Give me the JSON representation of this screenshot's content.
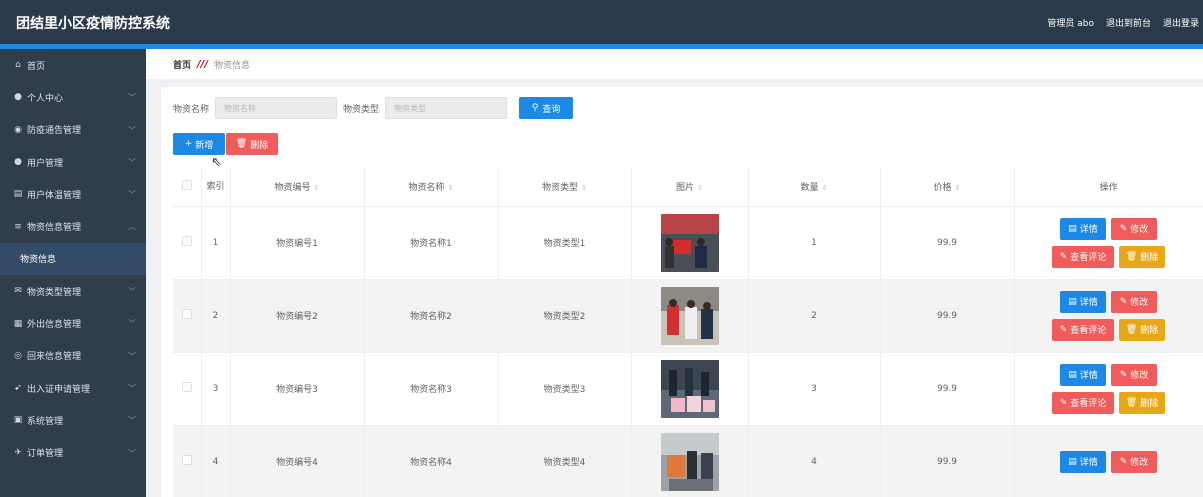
{
  "header": {
    "app_title": "团结里小区疫情防控系统",
    "admin_label": "管理员 abo",
    "back_frontend": "退出到前台",
    "logout": "退出登录"
  },
  "sidebar": {
    "items": [
      {
        "label": "首页",
        "icon": "home-icon"
      },
      {
        "label": "个人中心",
        "icon": "user-icon"
      },
      {
        "label": "防疫通告管理",
        "icon": "pin-icon"
      },
      {
        "label": "用户管理",
        "icon": "user-icon"
      },
      {
        "label": "用户体温管理",
        "icon": "doc-icon"
      },
      {
        "label": "物资信息管理",
        "icon": "menu-icon"
      },
      {
        "label": "物资信息",
        "icon": ""
      },
      {
        "label": "物资类型管理",
        "icon": "mail-icon"
      },
      {
        "label": "外出信息管理",
        "icon": "grid-icon"
      },
      {
        "label": "回来信息管理",
        "icon": "circle-icon"
      },
      {
        "label": "出入证申请管理",
        "icon": "send-icon"
      },
      {
        "label": "系统管理",
        "icon": "screen-icon"
      },
      {
        "label": "订单管理",
        "icon": "plane-icon"
      }
    ]
  },
  "breadcrumb": {
    "home": "首页",
    "separator": "///",
    "current": "物资信息"
  },
  "search": {
    "name_label": "物资名称",
    "name_placeholder": "物资名称",
    "type_label": "物资类型",
    "type_placeholder": "物资类型",
    "search_button": "查询"
  },
  "actions": {
    "add": "新增",
    "delete": "删除"
  },
  "table": {
    "headers": [
      "",
      "索引",
      "物资编号",
      "物资名称",
      "物资类型",
      "图片",
      "数量",
      "价格",
      "操作"
    ],
    "rows": [
      {
        "index": "1",
        "code": "物资编号1",
        "name": "物资名称1",
        "type": "物资类型1",
        "qty": "1",
        "price": "99.9"
      },
      {
        "index": "2",
        "code": "物资编号2",
        "name": "物资名称2",
        "type": "物资类型2",
        "qty": "2",
        "price": "99.9"
      },
      {
        "index": "3",
        "code": "物资编号3",
        "name": "物资名称3",
        "type": "物资类型3",
        "qty": "3",
        "price": "99.9"
      },
      {
        "index": "4",
        "code": "物资编号4",
        "name": "物资名称4",
        "type": "物资类型4",
        "qty": "4",
        "price": "99.9"
      }
    ],
    "op_labels": {
      "detail": "详情",
      "edit": "修改",
      "review": "查看评论",
      "remove": "删除"
    }
  },
  "colors": {
    "header_bg": "#2b3a4a",
    "sidebar_bg": "#2f3d4d",
    "primary": "#1e88e5",
    "danger": "#f05b5b",
    "warning": "#e6a817"
  }
}
